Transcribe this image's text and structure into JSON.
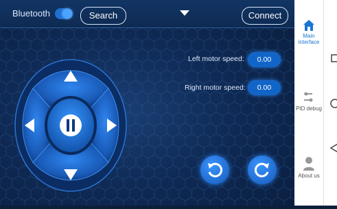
{
  "topbar": {
    "bluetooth_label": "Bluetooth",
    "search_label": "Search",
    "connect_label": "Connect",
    "bluetooth_toggle_on": true
  },
  "motors": {
    "left_label": "Left motor speed:",
    "left_value": "0.00",
    "right_label": "Right motor speed:",
    "right_value": "0.00"
  },
  "sidebar": {
    "items": [
      {
        "label_line1": "Main",
        "label_line2": "interface",
        "icon": "home-icon",
        "active": true
      },
      {
        "label_line1": "PID debug",
        "label_line2": "",
        "icon": "sliders-icon",
        "active": false
      },
      {
        "label_line1": "About us",
        "label_line2": "",
        "icon": "person-icon",
        "active": false
      }
    ]
  },
  "colors": {
    "accent": "#1976d2",
    "background": "#0f2a55",
    "button": "#1265c8"
  }
}
